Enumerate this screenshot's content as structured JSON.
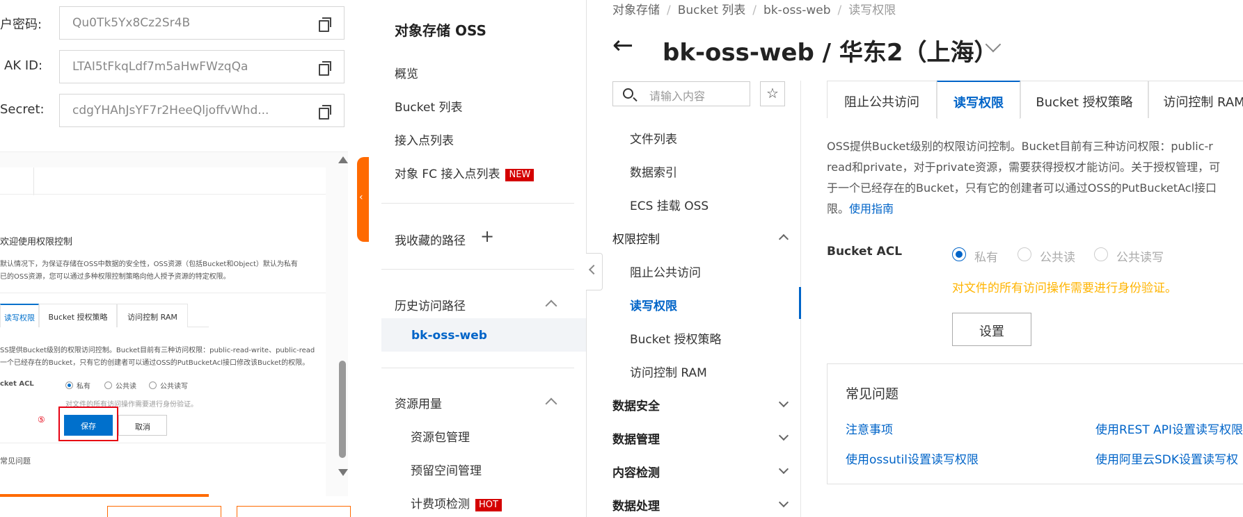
{
  "credentials": [
    {
      "label": "户密码:",
      "value": "Qu0Tk5Yx8Cz2Sr4B"
    },
    {
      "label": "AK ID:",
      "value": "LTAI5tFkqLdf7m5aHwFWzqQa"
    },
    {
      "label": "Secret:",
      "value": "cdgYHAhJsYF7r2HeeQljoffvWhd..."
    }
  ],
  "tutorial": {
    "title": "欢迎使用权限控制",
    "intro_1": "默认情况下，为保证存储在OSS中数据的安全性，OSS资源（包括Bucket和Object）默认为私有",
    "intro_2": "已的OSS资源，您可以通过多种权限控制策略向他人授予资源的特定权限。",
    "tabs": [
      "读写权限",
      "Bucket 授权策略",
      "访问控制 RAM"
    ],
    "desc_1": "SS提供Bucket级别的权限访问控制。Bucket目前有三种访问权限：public-read-write、public-read",
    "desc_2": "一个已经存在的Bucket，只有它的创建者可以通过OSS的PutBucketAcl接口修改该Bucket的权限。",
    "acl_label": "cket ACL",
    "options": [
      "私有",
      "公共读",
      "公共读写"
    ],
    "hint": "对文件的所有访问操作需要进行身份验证。",
    "step": "⑤",
    "save": "保存",
    "cancel": "取消",
    "faq": "常见问题",
    "progress": 0.6
  },
  "sidebar": {
    "title": "对象存储 OSS",
    "items": [
      "概览",
      "Bucket 列表",
      "接入点列表",
      "对象 FC 接入点列表"
    ],
    "new_badge": "NEW",
    "favorites": "我收藏的路径",
    "history": "历史访问路径",
    "history_item": "bk-oss-web",
    "resources": "资源用量",
    "resource_items": [
      "资源包管理",
      "预留空间管理",
      "计费项检测"
    ],
    "hot_badge": "HOT"
  },
  "breadcrumb": [
    "对象存储",
    "Bucket 列表",
    "bk-oss-web",
    "读写权限"
  ],
  "page_title": "bk-oss-web / 华东2（上海）",
  "search_placeholder": "请输入内容",
  "nav": {
    "top_items": [
      "文件列表",
      "数据索引",
      "ECS 挂载 OSS"
    ],
    "perm_group": "权限控制",
    "perm_items": [
      "阻止公共访问",
      "读写权限",
      "Bucket 授权策略",
      "访问控制 RAM"
    ],
    "groups": [
      "数据安全",
      "数据管理",
      "内容检测",
      "数据处理"
    ]
  },
  "tabs": [
    "阻止公共访问",
    "读写权限",
    "Bucket 授权策略",
    "访问控制 RAM"
  ],
  "description": {
    "line1": "OSS提供Bucket级别的权限访问控制。Bucket目前有三种访问权限：public-r",
    "line2": "read和private，对于private资源，需要获得授权才能访问。关于授权管理，可",
    "line3": "于一个已经存在的Bucket，只有它的创建者可以通过OSS的PutBucketAcl接口",
    "line4": "限。",
    "link": "使用指南"
  },
  "acl": {
    "label": "Bucket ACL",
    "options": [
      "私有",
      "公共读",
      "公共读写"
    ],
    "selected": "私有",
    "hint": "对文件的所有访问操作需要进行身份验证。",
    "button": "设置"
  },
  "faq": {
    "title": "常见问题",
    "links": [
      "注意事项",
      "使用REST API设置读写权限",
      "使用ossutil设置读写权限",
      "使用阿里云SDK设置读写权"
    ]
  },
  "colors": {
    "primary": "#0064c8",
    "orange": "#ff6a00",
    "warning": "#ffb400",
    "badge": "#d40000"
  }
}
